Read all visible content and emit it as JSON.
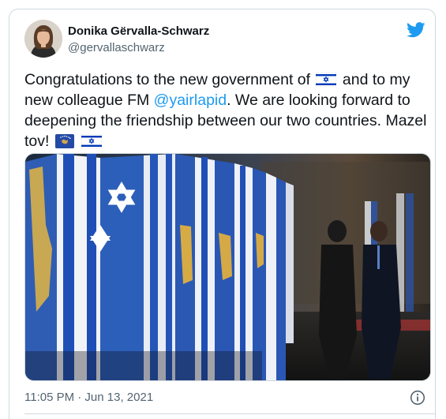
{
  "author": {
    "name": "Donika Gërvalla-Schwarz",
    "handle": "@gervallaschwarz"
  },
  "tweet": {
    "text_part1": "Congratulations to the new government of",
    "text_part2": "and to my new colleague FM",
    "mention": "@yairlapid",
    "text_part3": ". We are looking forward to deepening the friendship between our two countries. Mazel tov!",
    "timestamp": "11:05 PM · Jun 13, 2021"
  },
  "icons": {
    "brand": "twitter-bird-icon",
    "flags": [
      "israel-flag-emoji",
      "kosovo-flag-emoji",
      "israel-flag-emoji"
    ],
    "info": "info-icon"
  },
  "colors": {
    "accent": "#1d9bf0",
    "text": "#0f1419",
    "secondary": "#536471",
    "israel_blue": "#0038b8",
    "kosovo_blue": "#244aa5",
    "kosovo_gold": "#d0a650"
  }
}
